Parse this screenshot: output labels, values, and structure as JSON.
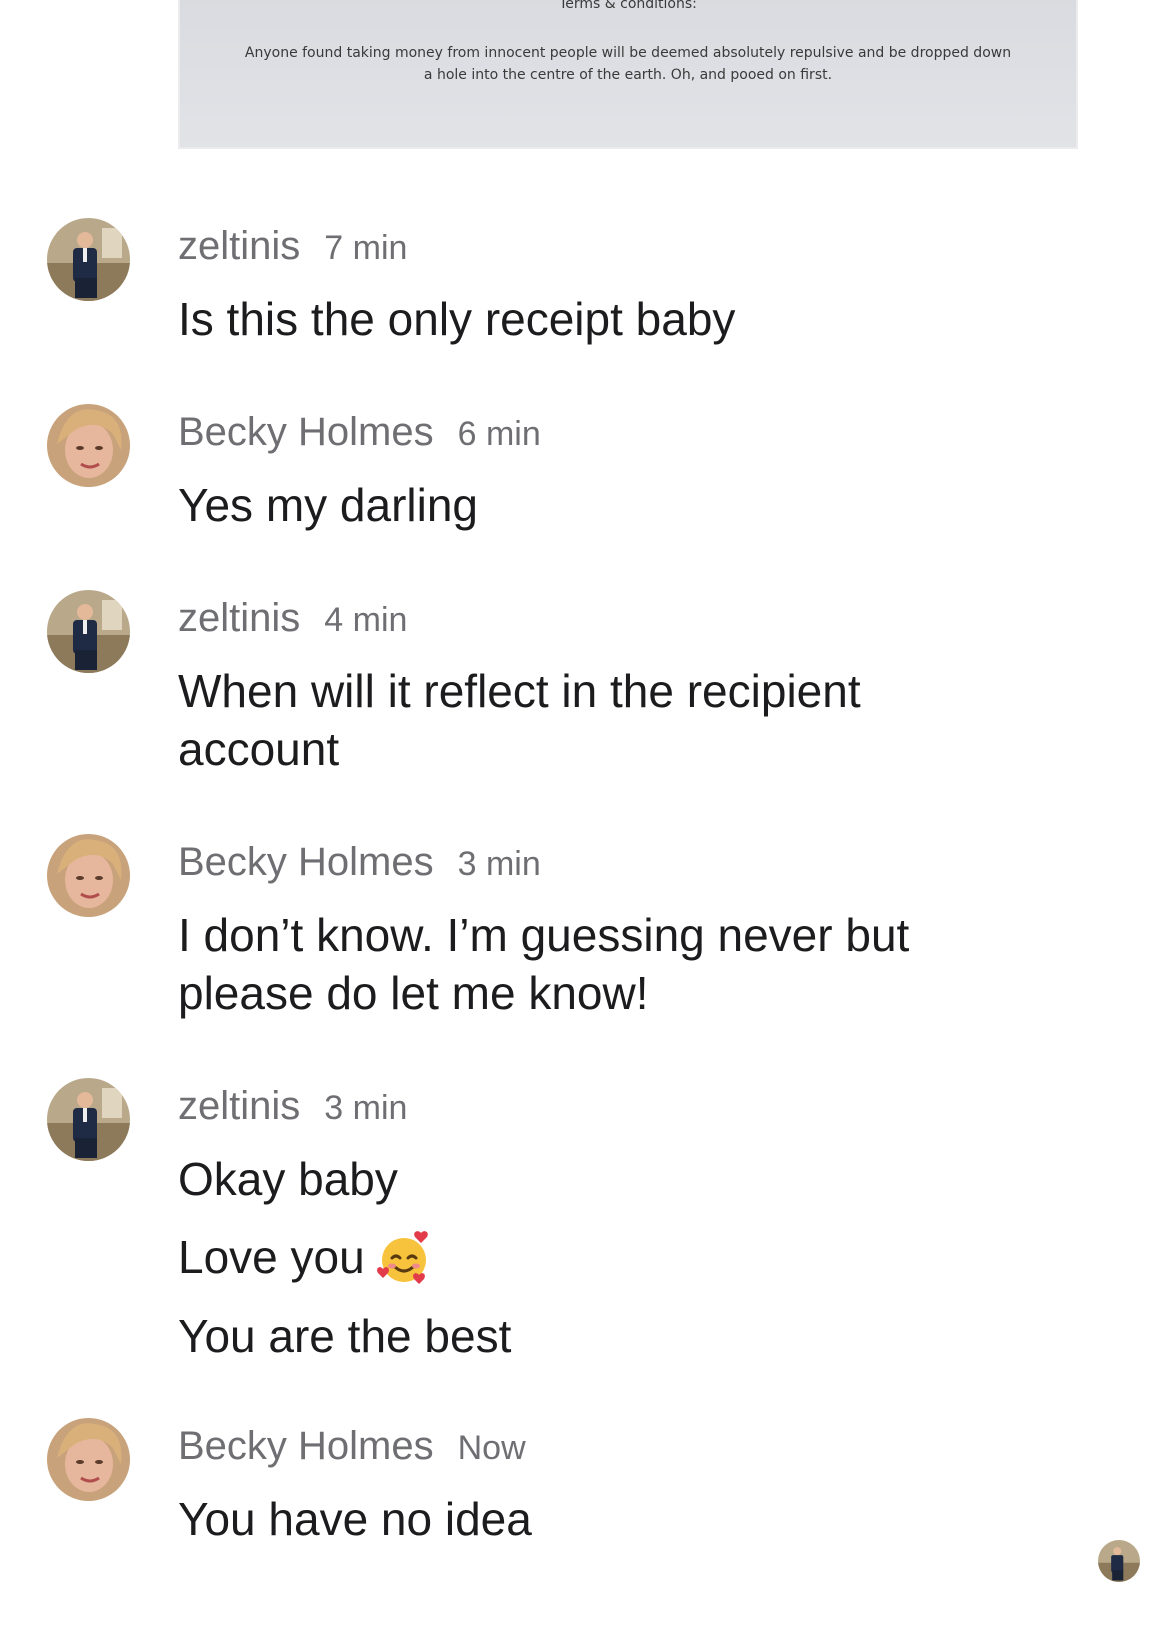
{
  "receipt": {
    "heading": "Terms & conditions:",
    "body": "Anyone found taking money from innocent people will be deemed absolutely repulsive and be dropped down a hole into the centre of the earth. Oh, and pooed on first."
  },
  "messages": [
    {
      "author": "zeltinis",
      "time": "7 min",
      "avatar": "man-in-suit-avatar",
      "lines": [
        "Is this the only receipt baby"
      ]
    },
    {
      "author": "Becky Holmes",
      "time": "6 min",
      "avatar": "blonde-woman-avatar",
      "lines": [
        "Yes my darling"
      ]
    },
    {
      "author": "zeltinis",
      "time": "4 min",
      "avatar": "man-in-suit-avatar",
      "lines": [
        "When will it reflect in the recipient account"
      ]
    },
    {
      "author": "Becky Holmes",
      "time": "3 min",
      "avatar": "blonde-woman-avatar",
      "lines": [
        "I don’t know. I’m guessing never but please do let me know!"
      ]
    },
    {
      "author": "zeltinis",
      "time": "3 min",
      "avatar": "man-in-suit-avatar",
      "lines": [
        "Okay baby",
        "Love you",
        "You are the best"
      ],
      "emoji": "smiling-face-with-hearts"
    },
    {
      "author": "Becky Holmes",
      "time": "Now",
      "avatar": "blonde-woman-avatar",
      "lines": [
        "You have no idea"
      ]
    }
  ],
  "read_receipt": {
    "avatar": "man-in-suit-avatar"
  }
}
